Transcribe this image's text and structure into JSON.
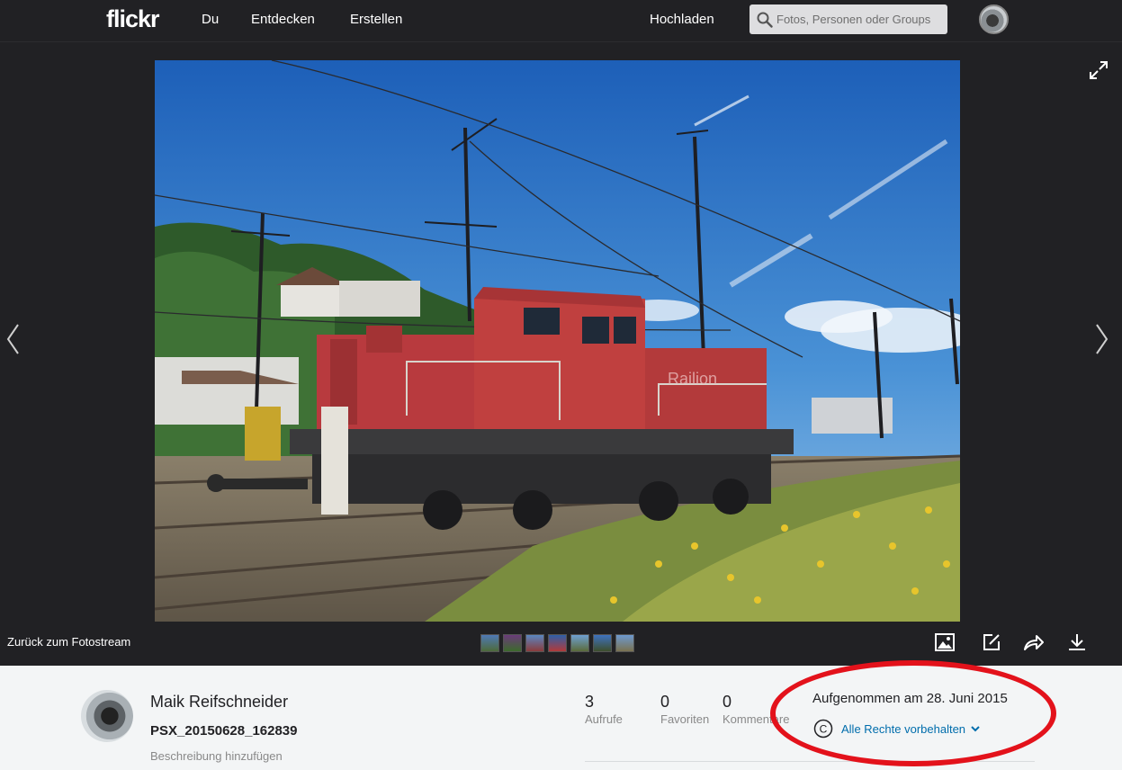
{
  "nav": {
    "logo": "flickr",
    "items": [
      "Du",
      "Entdecken",
      "Erstellen"
    ],
    "upload": "Hochladen",
    "search_placeholder": "Fotos, Personen oder Groups"
  },
  "viewer": {
    "back_link": "Zurück zum Fotostream",
    "thumbnail_count": 7
  },
  "info": {
    "owner": "Maik Reifschneider",
    "title": "PSX_20150628_162839",
    "description_link": "Beschreibung hinzufügen",
    "stats": [
      {
        "value": "3",
        "label": "Aufrufe"
      },
      {
        "value": "0",
        "label": "Favoriten"
      },
      {
        "value": "0",
        "label": "Kommentare"
      }
    ],
    "taken": "Aufgenommen am 28. Juni 2015",
    "license_icon": "©",
    "license": "Alle Rechte vorbehalten"
  },
  "colors": {
    "topbar": "#212124",
    "link_blue": "#006dac",
    "annotation_red": "#e3121b",
    "locomotive_red": "#b83a3e"
  },
  "icons": [
    "search-icon",
    "fullscreen-icon",
    "chevron-left-icon",
    "chevron-right-icon",
    "image-icon",
    "edit-icon",
    "share-icon",
    "download-icon",
    "chevron-down-icon",
    "copyright-icon"
  ]
}
